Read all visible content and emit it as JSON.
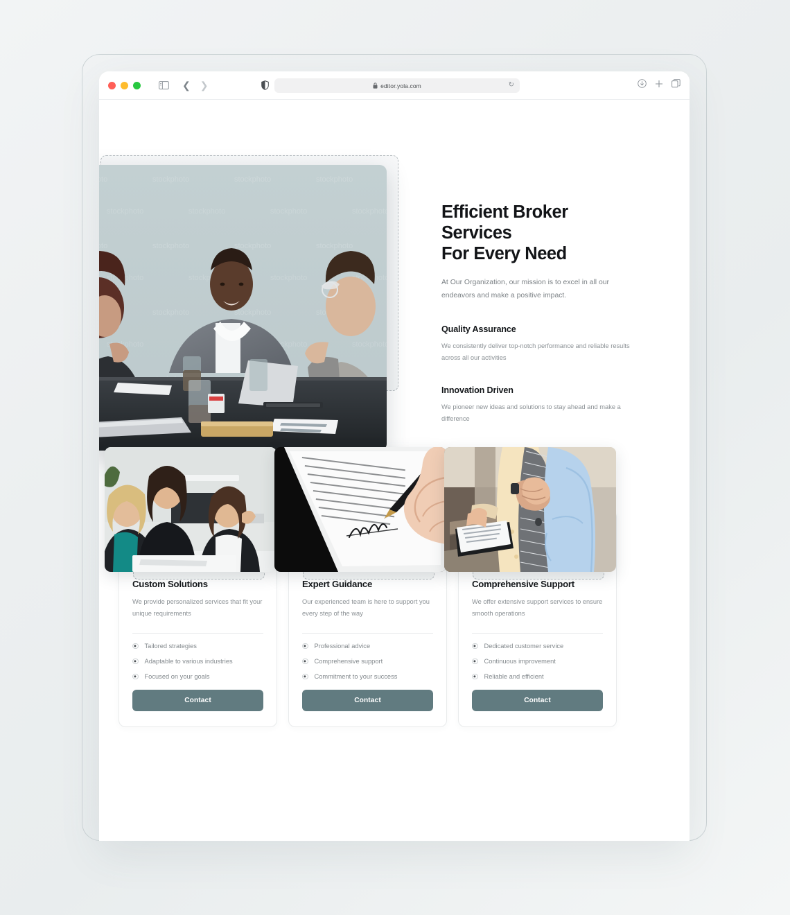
{
  "browser": {
    "traffic_lights": [
      "close",
      "minimize",
      "maximize"
    ],
    "sidebar_icon": "sidebar-icon",
    "back_icon": "chevron-left-icon",
    "forward_icon": "chevron-right-icon",
    "shield_icon": "shield-icon",
    "lock_icon": "lock-icon",
    "url": "editor.yola.com",
    "reload_icon": "reload-icon",
    "download_icon": "download-icon",
    "new_tab_icon": "plus-icon",
    "tabs_icon": "tabs-overview-icon"
  },
  "hero": {
    "title": "Efficient Broker Services For Every Need",
    "title_line1": "Efficient Broker Services",
    "title_line2": "For Every Need",
    "subtitle": "At Our Organization, our mission is to excel in all our endeavors and make a positive impact.",
    "image_alt": "business-meeting-photo",
    "features": [
      {
        "title": "Quality Assurance",
        "body": "We consistently deliver top-notch performance and reliable results across all our activities"
      },
      {
        "title": "Innovation Driven",
        "body": "We pioneer new ideas and solutions to stay ahead and make a difference"
      }
    ]
  },
  "cards": [
    {
      "image_alt": "team-collaboration-photo",
      "title": "Custom Solutions",
      "description": "We provide personalized services that fit your unique requirements",
      "bullets": [
        "Tailored strategies",
        "Adaptable to various industries",
        "Focused on your goals"
      ],
      "button_label": "Contact"
    },
    {
      "image_alt": "contract-signing-photo",
      "title": "Expert Guidance",
      "description": "Our experienced team is here to support you every step of the way",
      "bullets": [
        "Professional advice",
        "Comprehensive support",
        "Commitment to your success"
      ],
      "button_label": "Contact"
    },
    {
      "image_alt": "handshake-agreement-photo",
      "title": "Comprehensive Support",
      "description": "We offer extensive support services to ensure smooth operations",
      "bullets": [
        "Dedicated customer service",
        "Continuous improvement",
        "Reliable and efficient"
      ],
      "button_label": "Contact"
    }
  ],
  "colors": {
    "button": "#617b80",
    "heading": "#121417",
    "body_text": "#8a9094",
    "card_border": "#e9ebec",
    "selection_dashed": "#b6bcc0"
  }
}
